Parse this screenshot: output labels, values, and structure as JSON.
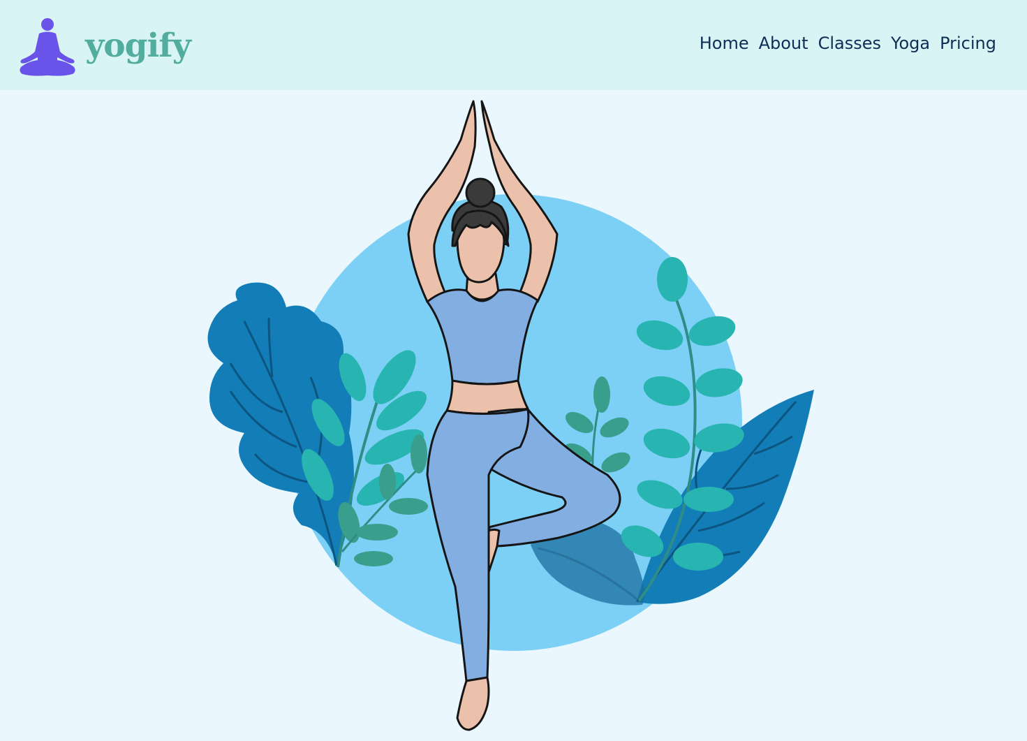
{
  "brand": {
    "name": "yogify",
    "icon": "meditation-person-icon",
    "color": "#52ad9f",
    "icon_color": "#6a53e8"
  },
  "nav": {
    "items": [
      {
        "label": "Home"
      },
      {
        "label": "About"
      },
      {
        "label": "Classes"
      },
      {
        "label": "Yoga"
      },
      {
        "label": "Pricing"
      }
    ],
    "color": "#0d2e57",
    "background": "#d9f4f4"
  },
  "hero": {
    "illustration": "woman-tree-pose-illustration",
    "background": "#eaf7fe",
    "circle_color": "#7dd0f5",
    "leaf_dark": "#137db8",
    "leaf_teal": "#28b5b1"
  }
}
